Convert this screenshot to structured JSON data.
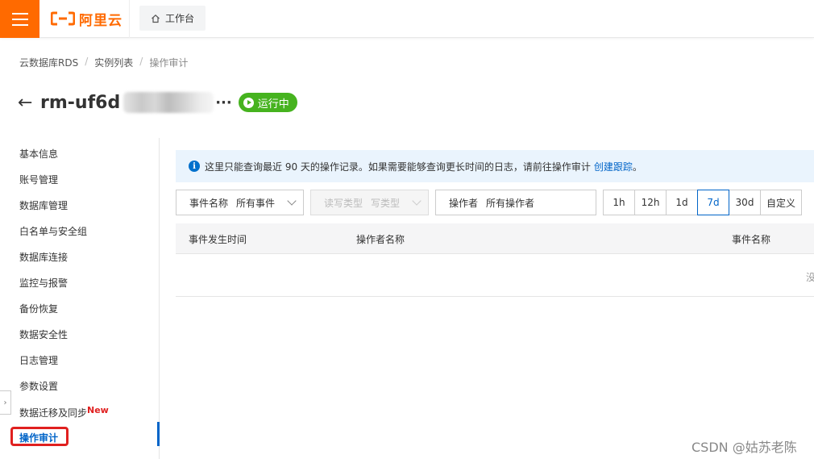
{
  "topbar": {
    "logo_text": "阿里云",
    "workbench_label": "工作台"
  },
  "breadcrumb": [
    "云数据库RDS",
    "实例列表",
    "操作审计"
  ],
  "instance": {
    "name_prefix": "rm-uf6d",
    "ellipsis": "···",
    "status": "运行中"
  },
  "sidebar": {
    "items": [
      {
        "label": "基本信息"
      },
      {
        "label": "账号管理"
      },
      {
        "label": "数据库管理"
      },
      {
        "label": "白名单与安全组"
      },
      {
        "label": "数据库连接"
      },
      {
        "label": "监控与报警"
      },
      {
        "label": "备份恢复"
      },
      {
        "label": "数据安全性"
      },
      {
        "label": "日志管理"
      },
      {
        "label": "参数设置"
      },
      {
        "label": "数据迁移及同步",
        "badge": "New"
      },
      {
        "label": "操作审计",
        "active": true
      }
    ]
  },
  "notice": {
    "text": "这里只能查询最近 90 天的操作记录。如果需要能够查询更长时间的日志，请前往操作审计",
    "link": "创建跟踪",
    "suffix": "。"
  },
  "filters": {
    "event_label": "事件名称",
    "event_value": "所有事件",
    "rw_label": "读写类型",
    "rw_value": "写类型",
    "operator_label": "操作者",
    "operator_value": "所有操作者"
  },
  "ranges": [
    "1h",
    "12h",
    "1d",
    "7d",
    "30d",
    "自定义"
  ],
  "selected_range": "7d",
  "table": {
    "headers": [
      "事件发生时间",
      "操作者名称",
      "事件名称"
    ],
    "empty_text": "没"
  },
  "watermark": "CSDN @姑苏老陈",
  "colors": {
    "brand": "#ff6a00",
    "accent": "#0064c8",
    "running": "#46b31f"
  }
}
